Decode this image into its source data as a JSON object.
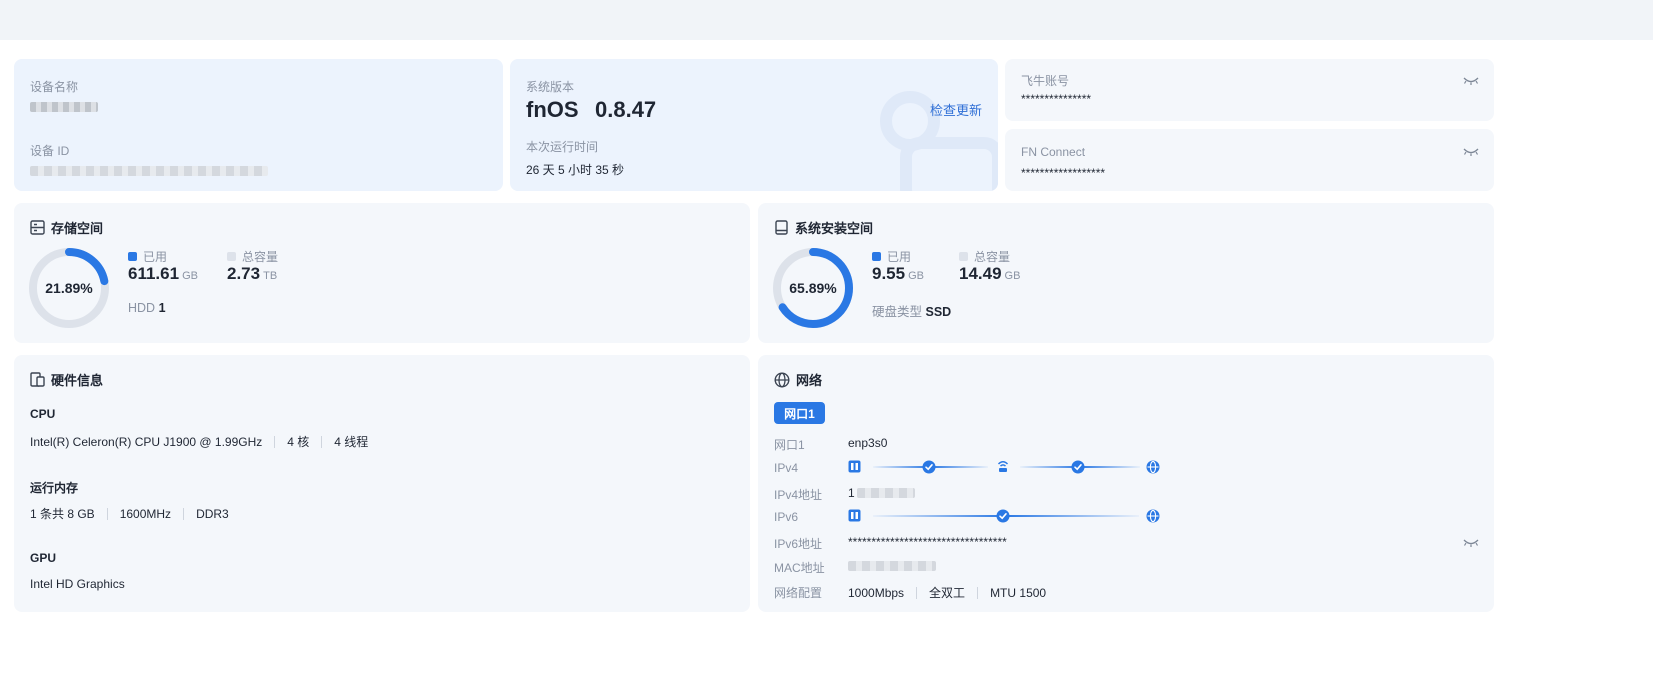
{
  "device": {
    "name_label": "设备名称",
    "id_label": "设备 ID"
  },
  "system": {
    "version_label": "系统版本",
    "os_name": "fnOS",
    "os_version": "0.8.47",
    "check_update": "检查更新",
    "uptime_label": "本次运行时间",
    "uptime_value": "26 天 5 小时 35 秒"
  },
  "account": {
    "label": "飞牛账号",
    "value": "***************"
  },
  "fn_connect": {
    "label": "FN Connect",
    "value": "******************"
  },
  "storage": {
    "title": "存储空间",
    "percent_text": "21.89%",
    "used_fraction": 0.2189,
    "used_label": "已用",
    "used_value": "611.61",
    "used_unit": "GB",
    "total_label": "总容量",
    "total_value": "2.73",
    "total_unit": "TB",
    "disk_type_label": "HDD",
    "disk_count": "1"
  },
  "sys_install": {
    "title": "系统安装空间",
    "percent_text": "65.89%",
    "used_fraction": 0.6589,
    "used_label": "已用",
    "used_value": "9.55",
    "used_unit": "GB",
    "total_label": "总容量",
    "total_value": "14.49",
    "total_unit": "GB",
    "disk_type_label": "硬盘类型",
    "disk_type_value": "SSD"
  },
  "hardware": {
    "title": "硬件信息",
    "cpu_label": "CPU",
    "cpu_model": "Intel(R) Celeron(R) CPU J1900 @ 1.99GHz",
    "cpu_cores": "4 核",
    "cpu_threads": "4 线程",
    "ram_label": "运行内存",
    "ram_count": "1 条共 8 GB",
    "ram_freq": "1600MHz",
    "ram_type": "DDR3",
    "gpu_label": "GPU",
    "gpu_model": "Intel HD Graphics"
  },
  "network": {
    "title": "网络",
    "tab_label": "网口1",
    "port_label": "网口1",
    "port_value": "enp3s0",
    "ipv4_label": "IPv4",
    "ipv4_addr_label": "IPv4地址",
    "ipv4_addr_value": "1",
    "ipv6_label": "IPv6",
    "ipv6_addr_label": "IPv6地址",
    "ipv6_addr_value": "**********************************",
    "mac_label": "MAC地址",
    "config_label": "网络配置",
    "speed": "1000Mbps",
    "duplex": "全双工",
    "mtu": "MTU 1500"
  },
  "colors": {
    "accent": "#2a78e4",
    "ring_track": "#dde2ea",
    "card_bg": "#f4f7fb",
    "card_blue_bg": "#ecf3fd"
  }
}
